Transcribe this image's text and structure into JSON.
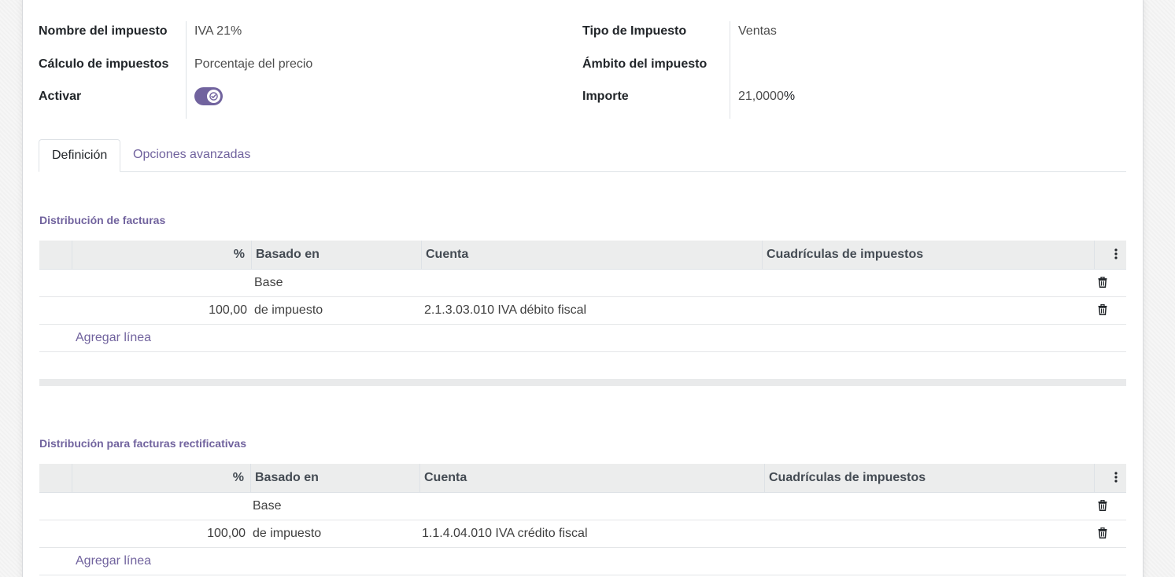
{
  "header_fields": {
    "nombre_label": "Nombre del impuesto",
    "nombre_value": "IVA 21%",
    "calculo_label": "Cálculo de impuestos",
    "calculo_value": "Porcentaje del precio",
    "activar_label": "Activar",
    "activar_checked": true,
    "tipo_label": "Tipo de Impuesto",
    "tipo_value": "Ventas",
    "ambito_label": "Ámbito del impuesto",
    "ambito_value": "",
    "importe_label": "Importe",
    "importe_value": "21,0000",
    "importe_unit": "%"
  },
  "tabs": [
    {
      "label": "Definición",
      "active": true
    },
    {
      "label": "Opciones avanzadas",
      "active": false
    }
  ],
  "invoice_distribution": {
    "title": "Distribución de facturas",
    "columns": [
      "%",
      "Basado en",
      "Cuenta",
      "Cuadrículas de impuestos"
    ],
    "rows": [
      {
        "percent": "",
        "based_on": "Base",
        "account": "",
        "grids": ""
      },
      {
        "percent": "100,00",
        "based_on": "de impuesto",
        "account": "2.1.3.03.010 IVA débito fiscal",
        "grids": ""
      }
    ],
    "add_line_label": "Agregar línea"
  },
  "refund_distribution": {
    "title": "Distribución para facturas rectificativas",
    "columns": [
      "%",
      "Basado en",
      "Cuenta",
      "Cuadrículas de impuestos"
    ],
    "rows": [
      {
        "percent": "",
        "based_on": "Base",
        "account": "",
        "grids": ""
      },
      {
        "percent": "100,00",
        "based_on": "de impuesto",
        "account": "1.1.4.04.010 IVA crédito fiscal",
        "grids": ""
      }
    ],
    "add_line_label": "Agregar línea"
  },
  "colors": {
    "accent": "#71639e",
    "header_bg": "#eceded"
  }
}
